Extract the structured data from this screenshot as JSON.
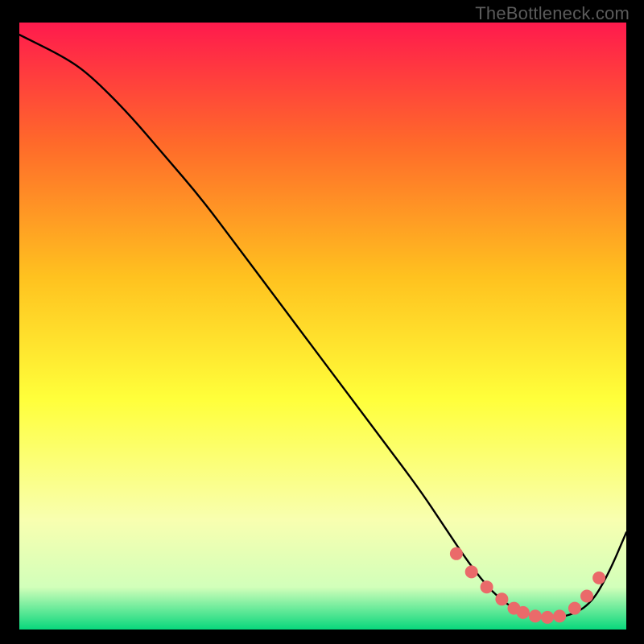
{
  "watermark": "TheBottleneck.com",
  "colors": {
    "frame_bg": "#000000",
    "gradient_top": "#ff1a4d",
    "gradient_mid1": "#ff6a2a",
    "gradient_mid2": "#ffc21f",
    "gradient_mid3": "#ffff3a",
    "gradient_mid4": "#f8ffb0",
    "gradient_mid5": "#d2ffba",
    "gradient_bottom": "#08d77c",
    "curve": "#000000",
    "dot_fill": "#ea6a6a",
    "dot_stroke": "#c94d4d"
  },
  "chart_data": {
    "type": "line",
    "title": "",
    "xlabel": "",
    "ylabel": "",
    "xlim": [
      0,
      100
    ],
    "ylim": [
      0,
      100
    ],
    "series": [
      {
        "name": "bottleneck-curve",
        "x": [
          0,
          8,
          12,
          18,
          24,
          30,
          36,
          42,
          48,
          54,
          60,
          66,
          70,
          74,
          78,
          82,
          86,
          90,
          94,
          97,
          100
        ],
        "y": [
          98,
          94,
          91,
          85,
          78,
          71,
          63,
          55,
          47,
          39,
          31,
          23,
          17,
          11,
          6,
          3,
          2,
          2,
          4,
          9,
          16
        ]
      }
    ],
    "markers": {
      "name": "sweet-spot-dots",
      "x": [
        72,
        74.5,
        77,
        79.5,
        81.5,
        83,
        85,
        87,
        89,
        91.5,
        93.5,
        95.5
      ],
      "y": [
        12.5,
        9.5,
        7.0,
        5.0,
        3.5,
        2.8,
        2.2,
        2.0,
        2.2,
        3.5,
        5.5,
        8.5
      ]
    }
  }
}
